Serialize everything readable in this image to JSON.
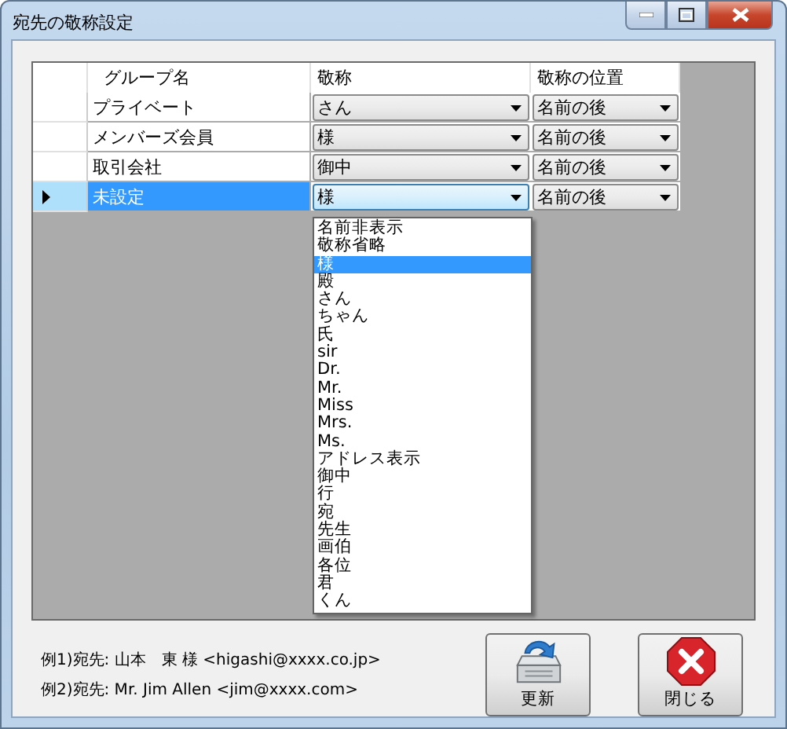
{
  "window": {
    "title": "宛先の敬称設定"
  },
  "table": {
    "columns": [
      "グループ名",
      "敬称",
      "敬称の位置"
    ],
    "rows": [
      {
        "group": "プライベート",
        "honorific": "さん",
        "position": "名前の後",
        "selected": false
      },
      {
        "group": "メンバーズ会員",
        "honorific": "様",
        "position": "名前の後",
        "selected": false
      },
      {
        "group": "取引会社",
        "honorific": "御中",
        "position": "名前の後",
        "selected": false
      },
      {
        "group": "未設定",
        "honorific": "様",
        "position": "名前の後",
        "selected": true
      }
    ]
  },
  "dropdown": {
    "items": [
      {
        "label": "名前非表示",
        "selected": false
      },
      {
        "label": "敬称省略",
        "selected": false
      },
      {
        "label": "様",
        "selected": true
      },
      {
        "label": "殿",
        "selected": false
      },
      {
        "label": "さん",
        "selected": false
      },
      {
        "label": "ちゃん",
        "selected": false
      },
      {
        "label": "氏",
        "selected": false
      },
      {
        "label": "sir",
        "selected": false
      },
      {
        "label": "Dr.",
        "selected": false
      },
      {
        "label": "Mr.",
        "selected": false
      },
      {
        "label": "Miss",
        "selected": false
      },
      {
        "label": "Mrs.",
        "selected": false
      },
      {
        "label": "Ms.",
        "selected": false
      },
      {
        "label": "アドレス表示",
        "selected": false
      },
      {
        "label": "御中",
        "selected": false
      },
      {
        "label": "行",
        "selected": false
      },
      {
        "label": "宛",
        "selected": false
      },
      {
        "label": "先生",
        "selected": false
      },
      {
        "label": "画伯",
        "selected": false
      },
      {
        "label": "各位",
        "selected": false
      },
      {
        "label": "君",
        "selected": false
      },
      {
        "label": "くん",
        "selected": false
      }
    ]
  },
  "examples": [
    "例1)宛先: 山本　東 様 <higashi@xxxx.co.jp>",
    "例2)宛先: Mr. Jim Allen <jim@xxxx.com>"
  ],
  "buttons": [
    {
      "label": "更新",
      "kind": "update"
    },
    {
      "label": "閉じる",
      "kind": "close"
    }
  ]
}
